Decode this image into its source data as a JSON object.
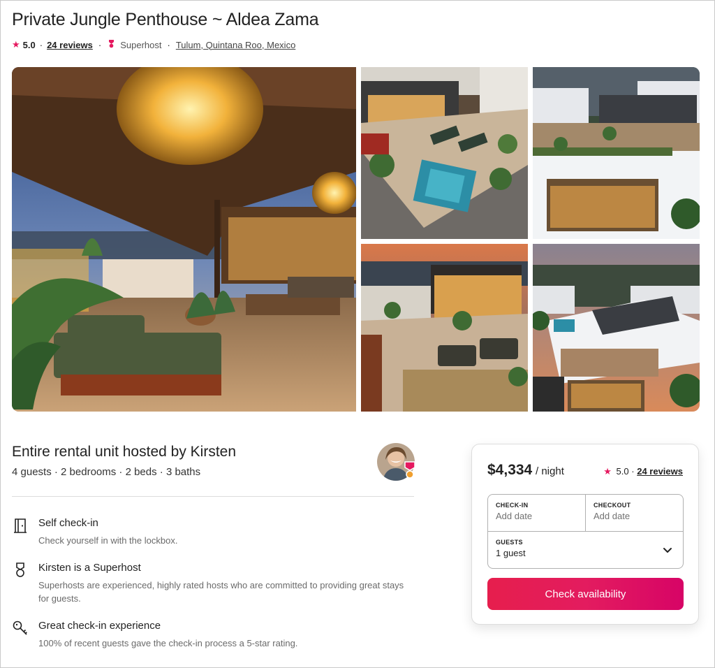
{
  "listing": {
    "title": "Private Jungle Penthouse ~ Aldea Zama",
    "rating": "5.0",
    "reviews": "24 reviews",
    "superhost": "Superhost",
    "location": "Tulum, Quintana Roo, Mexico"
  },
  "gallery": {
    "photos": [
      {
        "name": "rooftop-terrace-lounge-photo"
      },
      {
        "name": "rooftop-pool-aerial-photo"
      },
      {
        "name": "building-aerial-photo"
      },
      {
        "name": "terrace-sunset-photo"
      },
      {
        "name": "building-corner-aerial-photo"
      }
    ]
  },
  "host": {
    "heading": "Entire rental unit hosted by Kirsten",
    "summary": "4 guests · 2 bedrooms · 2 beds · 3 baths"
  },
  "features": [
    {
      "icon": "door-icon",
      "title": "Self check-in",
      "desc": "Check yourself in with the lockbox."
    },
    {
      "icon": "superhost-medal-icon",
      "title": "Kirsten is a Superhost",
      "desc": "Superhosts are experienced, highly rated hosts who are committed to providing great stays for guests."
    },
    {
      "icon": "key-icon",
      "title": "Great check-in experience",
      "desc": "100% of recent guests gave the check-in process a 5-star rating."
    }
  ],
  "booking": {
    "price": "$4,334",
    "per": "/ night",
    "rating": "5.0",
    "reviews": "24 reviews",
    "checkin_label": "CHECK-IN",
    "checkin_value": "Add date",
    "checkout_label": "CHECKOUT",
    "checkout_value": "Add date",
    "guests_label": "GUESTS",
    "guests_value": "1 guest",
    "cta": "Check availability"
  },
  "colors": {
    "brand": "#e31c5f",
    "text": "#222222",
    "muted": "#6a6a6a"
  }
}
